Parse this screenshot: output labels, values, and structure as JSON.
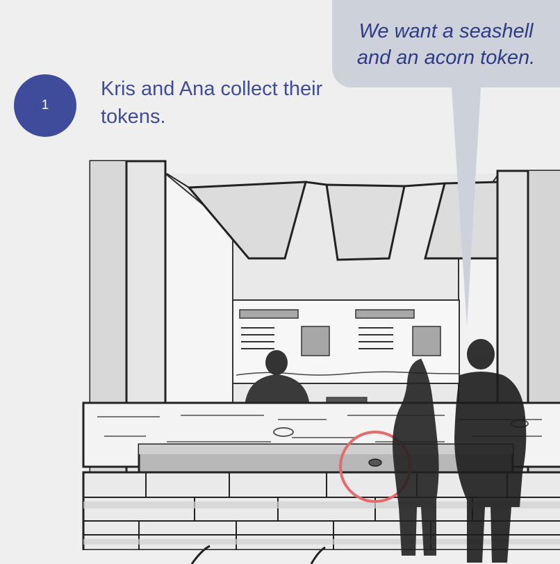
{
  "step": {
    "number": "1"
  },
  "caption": {
    "text": "Kris and Ana collect their tokens."
  },
  "speech_bubble": {
    "line1": "We want a seashell",
    "line2": "and an acorn token."
  },
  "colors": {
    "accent": "#3f4c9c",
    "bubble": "#ccd1da",
    "highlight_circle": "#e36b6b",
    "background": "#efefef"
  }
}
